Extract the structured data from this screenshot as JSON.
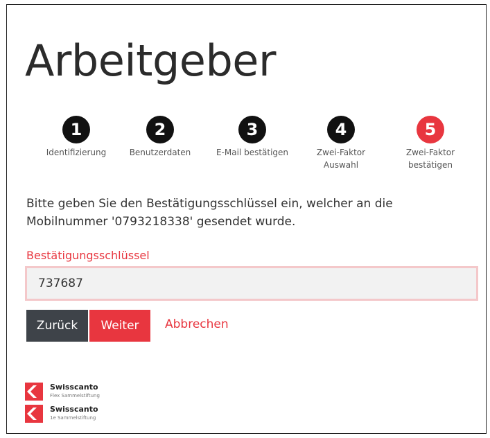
{
  "page": {
    "title": "Arbeitgeber"
  },
  "steps": [
    {
      "number": "1",
      "label": "Identifizierung",
      "state": "done"
    },
    {
      "number": "2",
      "label": "Benutzerdaten",
      "state": "done"
    },
    {
      "number": "3",
      "label": "E-Mail bestätigen",
      "state": "done"
    },
    {
      "number": "4",
      "label_line1": "Zwei-Faktor",
      "label_line2": "Auswahl",
      "state": "done"
    },
    {
      "number": "5",
      "label_line1": "Zwei-Faktor",
      "label_line2": "bestätigen",
      "state": "active"
    }
  ],
  "info": {
    "text": "Bitte geben Sie den Bestätigungsschlüssel ein, welcher an die Mobilnummer '0793218338' gesendet wurde."
  },
  "form": {
    "field_label": "Bestätigungsschlüssel",
    "field_value": "737687"
  },
  "actions": {
    "back_label": "Zurück",
    "next_label": "Weiter",
    "cancel_label": "Abbrechen"
  },
  "logos": [
    {
      "name": "Swisscanto",
      "sub": "Flex Sammelstiftung",
      "icon": "swisscanto-logo-icon"
    },
    {
      "name": "Swisscanto",
      "sub": "1e Sammelstiftung",
      "icon": "swisscanto-logo-icon"
    }
  ],
  "colors": {
    "accent": "#e8363f",
    "dark_button": "#3e4349",
    "step_done": "#111111"
  }
}
